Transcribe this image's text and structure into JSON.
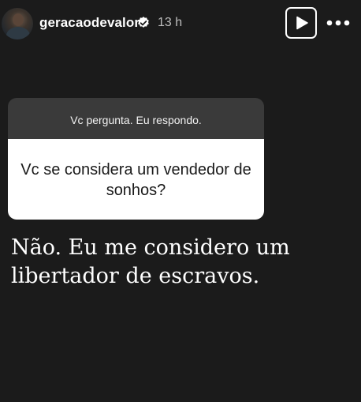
{
  "header": {
    "username": "geracaodevalor",
    "time": "13 h",
    "avatar_icon": "profile-photo",
    "verified_icon": "verified-badge-icon",
    "play_icon": "play-icon",
    "more_icon": "more-horizontal-icon"
  },
  "sticker": {
    "title": "Vc pergunta. Eu respondo.",
    "question": "Vc se considera um vendedor de sonhos?"
  },
  "answer": {
    "line1": "Não. Eu me considero um",
    "line2": "libertador de escravos."
  },
  "colors": {
    "background": "#1b1b1b",
    "sticker_header": "#3a3a3a",
    "sticker_body": "#ffffff",
    "text": "#ffffff",
    "time": "#bdbdbd"
  }
}
